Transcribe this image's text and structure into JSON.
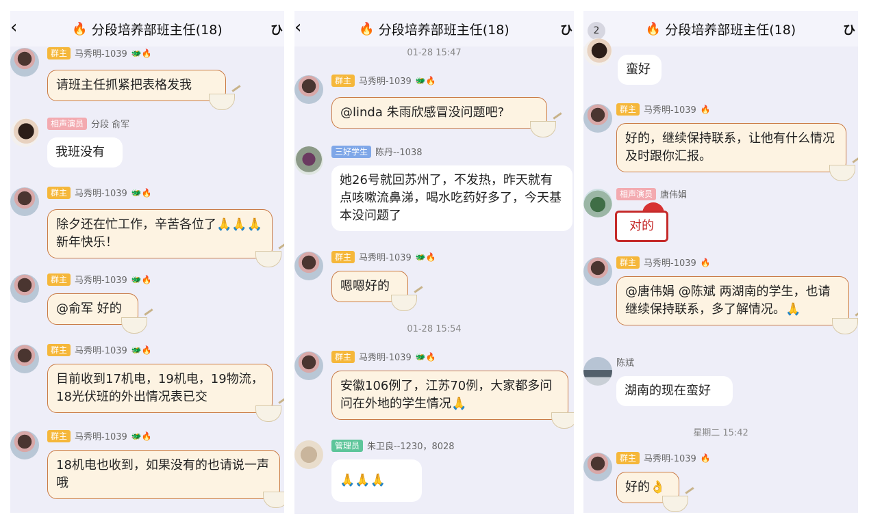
{
  "title": "分段培养部班主任(18)",
  "title_icon": "flame-icon",
  "colors": {
    "owner_bubble": "#fdf3e2",
    "owner_border": "#c97a44",
    "tag_owner": "#f5b73a",
    "tag_actor": "#f3aab0",
    "tag_student": "#7fa7e8",
    "tag_admin": "#5dc59a",
    "panel_bg": "#eeeef8"
  },
  "panel1": {
    "back_icon": "chevron-left-icon",
    "messages": [
      {
        "tag": "群主",
        "sender": "马秀明-1039",
        "text": "请班主任抓紧把表格发我"
      },
      {
        "tag": "相声演员",
        "sender": "分段 俞军",
        "text": "我班没有"
      },
      {
        "tag": "群主",
        "sender": "马秀明-1039",
        "text": "除夕还在忙工作，辛苦各位了🙏🙏🙏新年快乐！"
      },
      {
        "tag": "群主",
        "sender": "马秀明-1039",
        "text": "@俞军 好的"
      },
      {
        "tag": "群主",
        "sender": "马秀明-1039",
        "text": "目前收到17机电，19机电，19物流，18光伏班的外出情况表已交"
      },
      {
        "tag": "群主",
        "sender": "马秀明-1039",
        "text": "18机电也收到，如果没有的也请说一声哦"
      }
    ]
  },
  "panel2": {
    "back_icon": "chevron-left-icon",
    "time1": "01-28 15:47",
    "time2": "01-28 15:54",
    "messages": [
      {
        "tag": "群主",
        "sender": "马秀明-1039",
        "text": "@linda 朱雨欣感冒没问题吧?"
      },
      {
        "tag": "三好学生",
        "sender": "陈丹--1038",
        "text": "她26号就回苏州了，不发热，昨天就有点咳嗽流鼻涕，喝水吃药好多了，今天基本没问题了"
      },
      {
        "tag": "群主",
        "sender": "马秀明-1039",
        "text": "嗯嗯好的"
      },
      {
        "tag": "群主",
        "sender": "马秀明-1039",
        "text": "安徽106例了，江苏70例，大家都多问问在外地的学生情况🙏"
      },
      {
        "tag": "管理员",
        "sender": "朱卫良--1230，8028",
        "text": "🙏🙏🙏"
      }
    ]
  },
  "panel3": {
    "unread_badge": "2",
    "right_icon": "qq-logo-icon",
    "time1": "星期二 15:42",
    "messages": [
      {
        "text": "蛮好"
      },
      {
        "tag": "群主",
        "sender": "马秀明-1039",
        "text": "好的，继续保持联系，让他有什么情况及时跟你汇报。"
      },
      {
        "tag": "相声演员",
        "sender": "唐伟娟",
        "sticker": "对的"
      },
      {
        "tag": "群主",
        "sender": "马秀明-1039",
        "text": "@唐伟娟 @陈斌 两湖南的学生，也请继续保持联系，多了解情况。🙏"
      },
      {
        "sender": "陈斌",
        "text": "湖南的现在蛮好"
      },
      {
        "tag": "群主",
        "sender": "马秀明-1039",
        "text": "好的👌"
      }
    ]
  }
}
